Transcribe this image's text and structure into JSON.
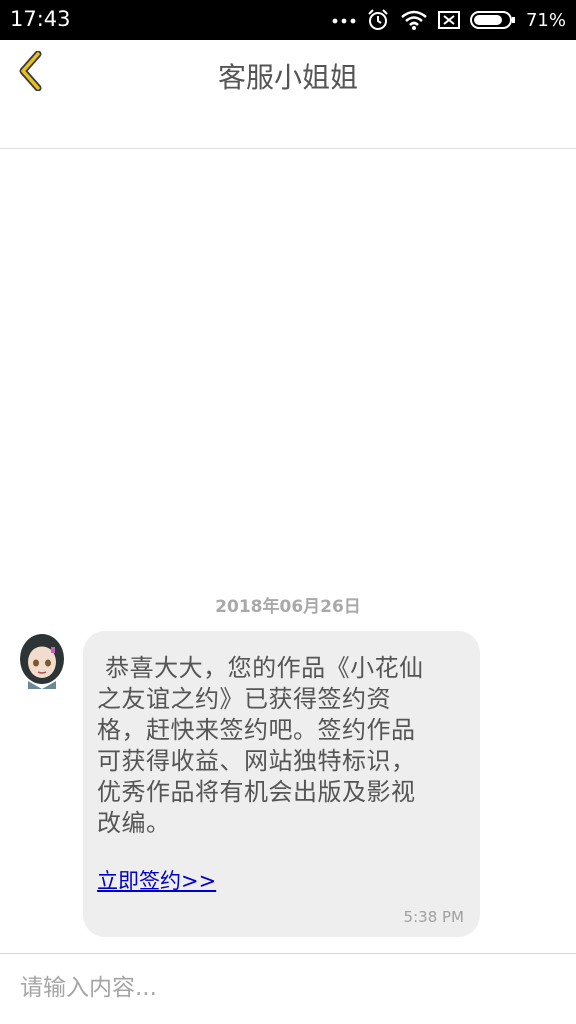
{
  "status_bar": {
    "time": "17:43",
    "battery_percent": "71%",
    "battery_level": 0.71,
    "icons": [
      "more-dots-icon",
      "alarm-icon",
      "wifi-icon",
      "sim-off-icon",
      "battery-icon"
    ]
  },
  "header": {
    "title": "客服小姐姐",
    "back_icon": "chevron-left-icon",
    "accent_color": "#e8c020"
  },
  "conversation": {
    "date": "2018年06月26日",
    "messages": [
      {
        "sender_avatar": "customer-service-avatar",
        "text": " 恭喜大大，您的作品《小花仙之友谊之约》已获得签约资格，赶快来签约吧。签约作品可获得收益、网站独特标识，优秀作品将有机会出版及影视改编。",
        "link_label": "立即签约>>",
        "time": "5:38 PM"
      }
    ]
  },
  "composer": {
    "placeholder": "请输入内容...",
    "value": ""
  }
}
